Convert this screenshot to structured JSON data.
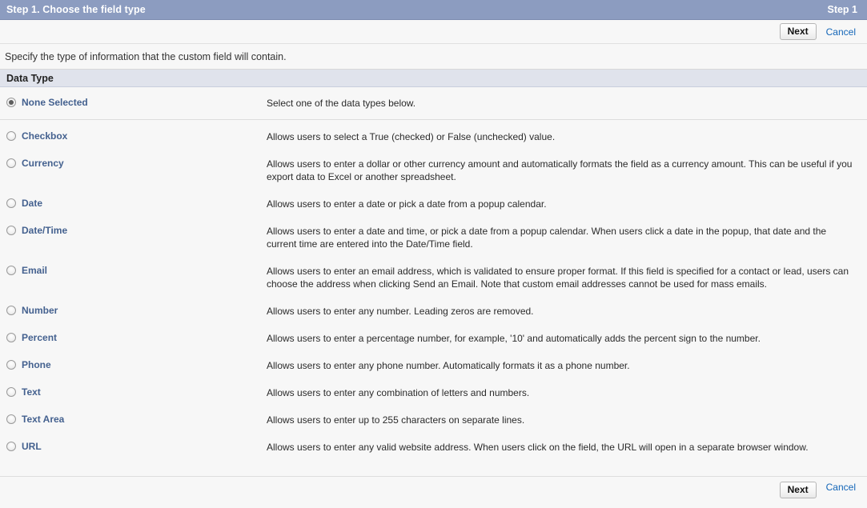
{
  "header": {
    "title": "Step 1. Choose the field type",
    "step_label": "Step 1"
  },
  "toolbar": {
    "next_label": "Next",
    "cancel_label": "Cancel"
  },
  "instruction": {
    "text": "Specify the type of information that the custom field will contain."
  },
  "section": {
    "title": "Data Type"
  },
  "data_types": [
    {
      "id": "none-selected",
      "label": "None Selected",
      "description": "Select one of the data types below.",
      "selected": true
    },
    {
      "id": "checkbox",
      "label": "Checkbox",
      "description": "Allows users to select a True (checked) or False (unchecked) value.",
      "selected": false
    },
    {
      "id": "currency",
      "label": "Currency",
      "description": "Allows users to enter a dollar or other currency amount and automatically formats the field as a currency amount. This can be useful if you export data to Excel or another spreadsheet.",
      "selected": false
    },
    {
      "id": "date",
      "label": "Date",
      "description": "Allows users to enter a date or pick a date from a popup calendar.",
      "selected": false
    },
    {
      "id": "date-time",
      "label": "Date/Time",
      "description": "Allows users to enter a date and time, or pick a date from a popup calendar. When users click a date in the popup, that date and the current time are entered into the Date/Time field.",
      "selected": false
    },
    {
      "id": "email",
      "label": "Email",
      "description": "Allows users to enter an email address, which is validated to ensure proper format. If this field is specified for a contact or lead, users can choose the address when clicking Send an Email. Note that custom email addresses cannot be used for mass emails.",
      "selected": false
    },
    {
      "id": "number",
      "label": "Number",
      "description": "Allows users to enter any number. Leading zeros are removed.",
      "selected": false
    },
    {
      "id": "percent",
      "label": "Percent",
      "description": "Allows users to enter a percentage number, for example, '10' and automatically adds the percent sign to the number.",
      "selected": false
    },
    {
      "id": "phone",
      "label": "Phone",
      "description": "Allows users to enter any phone number. Automatically formats it as a phone number.",
      "selected": false
    },
    {
      "id": "text",
      "label": "Text",
      "description": "Allows users to enter any combination of letters and numbers.",
      "selected": false
    },
    {
      "id": "text-area",
      "label": "Text Area",
      "description": "Allows users to enter up to 255 characters on separate lines.",
      "selected": false
    },
    {
      "id": "url",
      "label": "URL",
      "description": "Allows users to enter any valid website address. When users click on the field, the URL will open in a separate browser window.",
      "selected": false
    }
  ],
  "colors": {
    "header_bar": "#8c9cc0",
    "section_header": "#e0e3ec",
    "page_background": "#f7f7f7",
    "link": "#1466b8",
    "radio_label": "#44618f"
  }
}
